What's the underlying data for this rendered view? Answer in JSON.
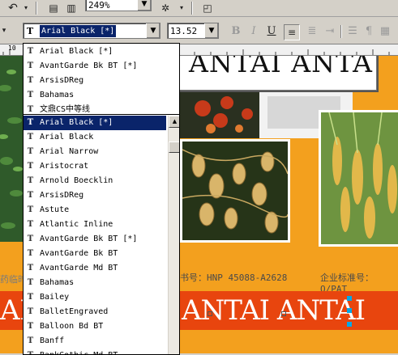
{
  "toolbar": {
    "zoom_value": "249%",
    "font_value": "Arial Black [*]",
    "size_value": "13.52"
  },
  "canvas": {
    "title_text": "ANTAI ANTA",
    "license_left": "药临时",
    "license_mid": "书号：HNP 45088-A2628",
    "license_right": "企业标准号：Q/PAT",
    "banner_text_left": "ANTAI",
    "banner_text_right": "ANTAI ANTAI"
  },
  "font_list": {
    "recent": [
      "Arial Black [*]",
      "AvantGarde Bk BT [*]",
      "ArsisDReg",
      "Bahamas",
      "文鼎CS中等线"
    ],
    "all": [
      "Arial Black [*]",
      "Arial Black",
      "Arial Narrow",
      "Aristocrat",
      "Arnold Boecklin",
      "ArsisDReg",
      "Astute",
      "Atlantic Inline",
      "AvantGarde Bk BT [*]",
      "AvantGarde Bk BT",
      "AvantGarde Md BT",
      "Bahamas",
      "Bailey",
      "BalletEngraved",
      "Balloon Bd BT",
      "Banff",
      "BankGothic Md BT"
    ],
    "selected": "Arial Black [*]"
  },
  "ruler": {
    "label": "10"
  },
  "colors": {
    "orange": "#f3a01e",
    "deep_orange": "#e8450e",
    "selection": "#0a246a"
  }
}
